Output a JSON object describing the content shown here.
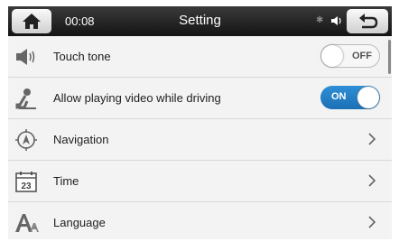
{
  "header": {
    "time": "00:08",
    "title": "Setting",
    "home_icon": "home-icon",
    "back_icon": "back-arrow-icon"
  },
  "rows": [
    {
      "label": "Touch tone",
      "icon": "speaker-icon",
      "control": "toggle",
      "state": "OFF"
    },
    {
      "label": "Allow playing video while driving",
      "icon": "driver-icon",
      "control": "toggle",
      "state": "ON"
    },
    {
      "label": "Navigation",
      "icon": "compass-icon",
      "control": "chevron"
    },
    {
      "label": "Time",
      "icon": "calendar-icon",
      "calendar_day": "23",
      "control": "chevron"
    },
    {
      "label": "Language",
      "icon": "font-icon",
      "control": "chevron"
    }
  ],
  "colors": {
    "accent": "#1f78c1",
    "header": "#1e1e1e"
  }
}
